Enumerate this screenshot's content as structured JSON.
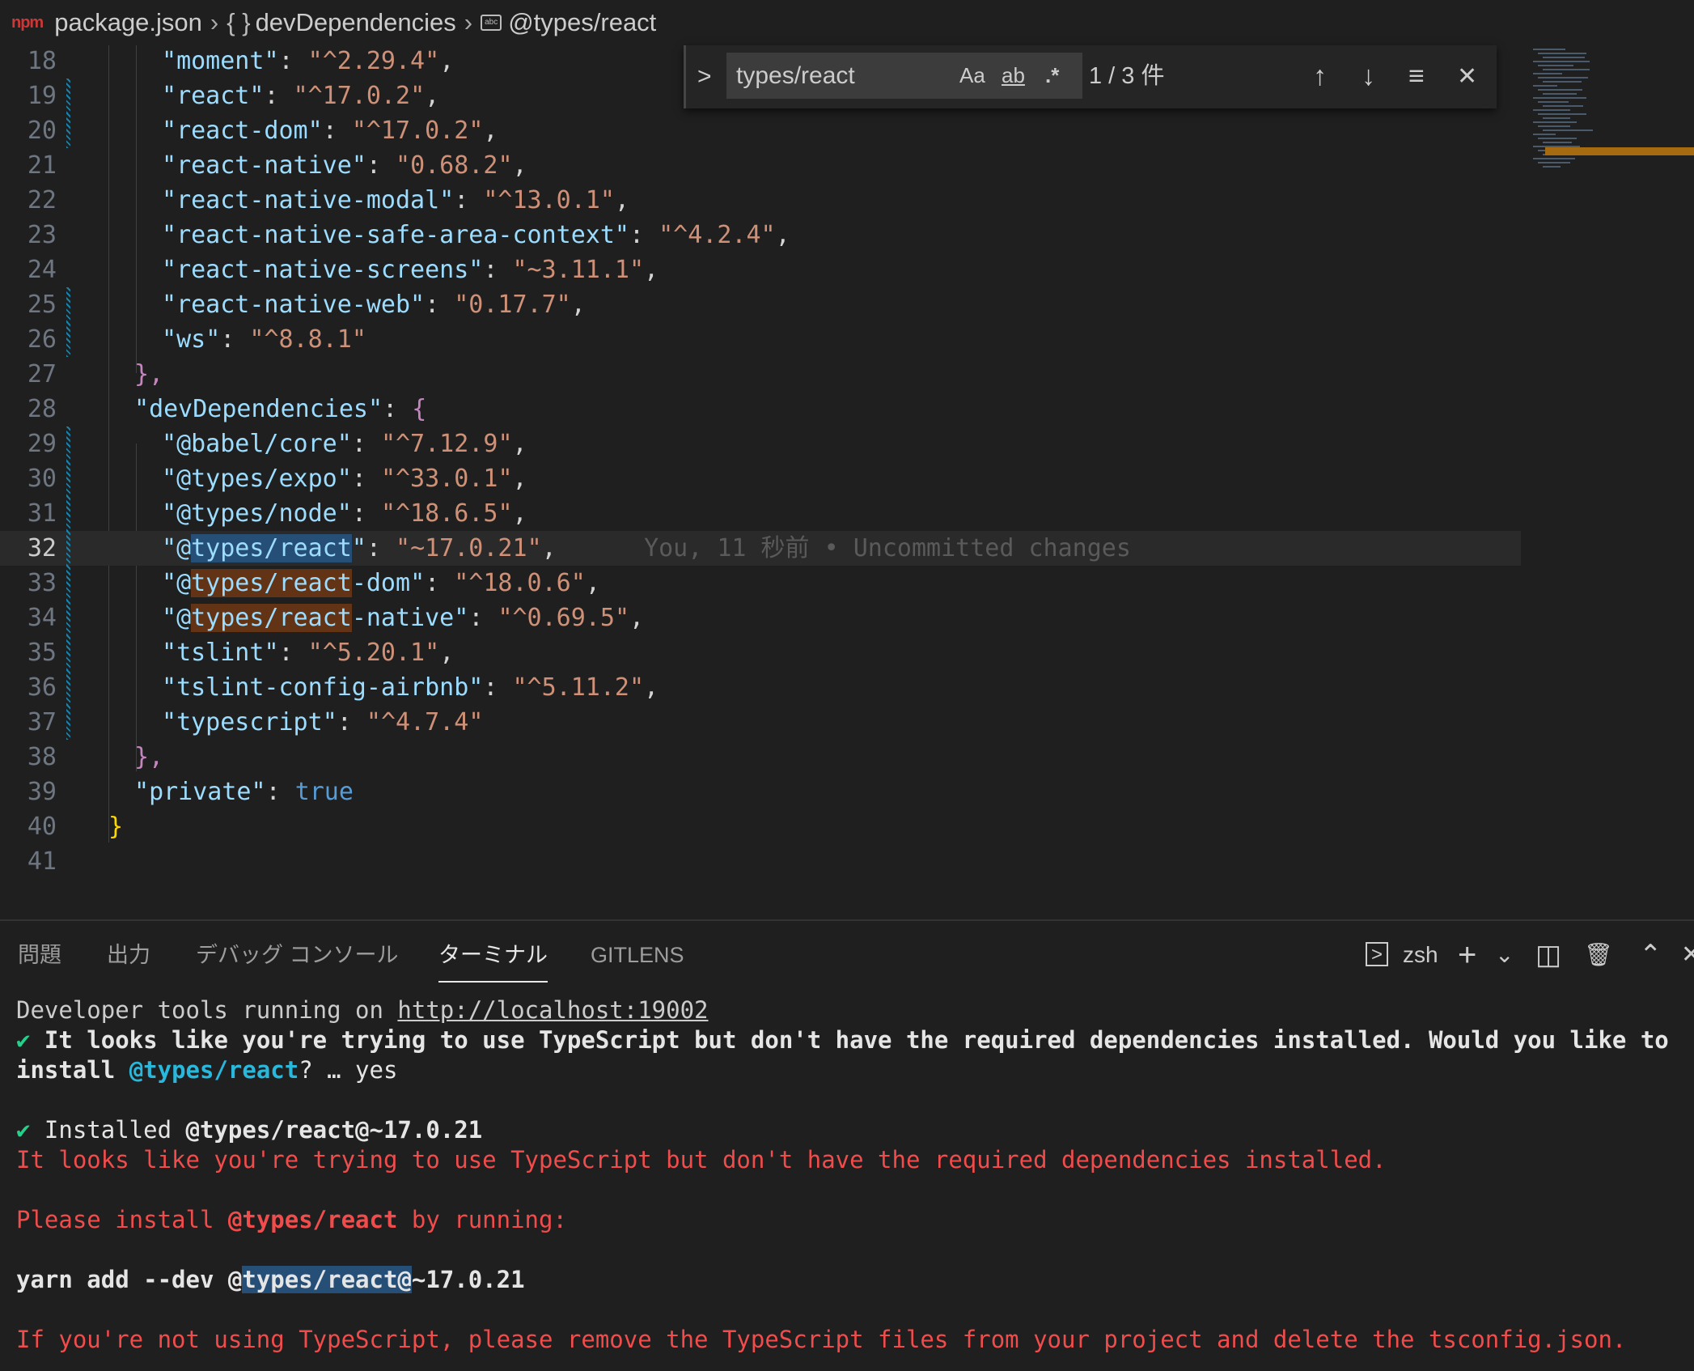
{
  "breadcrumb": {
    "file_badge": "npm",
    "file": "package.json",
    "braces_icon": "{ }",
    "section": "devDependencies",
    "leaf": "@types/react"
  },
  "code_lines": [
    {
      "num": "18",
      "key": "moment",
      "value": "^2.29.4",
      "trail": ","
    },
    {
      "num": "19",
      "key": "react",
      "value": "^17.0.2",
      "trail": ","
    },
    {
      "num": "20",
      "key": "react-dom",
      "value": "^17.0.2",
      "trail": ","
    },
    {
      "num": "21",
      "key": "react-native",
      "value": "0.68.2",
      "trail": ","
    },
    {
      "num": "22",
      "key": "react-native-modal",
      "value": "^13.0.1",
      "trail": ","
    },
    {
      "num": "23",
      "key": "react-native-safe-area-context",
      "value": "^4.2.4",
      "trail": ","
    },
    {
      "num": "24",
      "key": "react-native-screens",
      "value": "~3.11.1",
      "trail": ","
    },
    {
      "num": "25",
      "key": "react-native-web",
      "value": "0.17.7",
      "trail": ","
    },
    {
      "num": "26",
      "key": "ws",
      "value": "^8.8.1",
      "trail": ""
    },
    {
      "num": "27",
      "text": "},"
    },
    {
      "num": "28",
      "key": "devDependencies",
      "open": "{"
    },
    {
      "num": "29",
      "key": "@babel/core",
      "value": "^7.12.9",
      "trail": ","
    },
    {
      "num": "30",
      "key": "@types/expo",
      "value": "^33.0.1",
      "trail": ","
    },
    {
      "num": "31",
      "key": "@types/node",
      "value": "^18.6.5",
      "trail": ","
    },
    {
      "num": "32",
      "key_pre": "@",
      "key_match": "types/react",
      "key_post": "",
      "value": "~17.0.21",
      "trail": ",",
      "annotation": "You, 11 秒前 • Uncommitted changes"
    },
    {
      "num": "33",
      "key_pre": "@",
      "key_match": "types/react",
      "key_post": "-dom",
      "value": "^18.0.6",
      "trail": ","
    },
    {
      "num": "34",
      "key_pre": "@",
      "key_match": "types/react",
      "key_post": "-native",
      "value": "^0.69.5",
      "trail": ","
    },
    {
      "num": "35",
      "key": "tslint",
      "value": "^5.20.1",
      "trail": ","
    },
    {
      "num": "36",
      "key": "tslint-config-airbnb",
      "value": "^5.11.2",
      "trail": ","
    },
    {
      "num": "37",
      "key": "typescript",
      "value": "^4.7.4",
      "trail": ""
    },
    {
      "num": "38",
      "text": "},"
    },
    {
      "num": "39",
      "key": "private",
      "bool": "true"
    },
    {
      "num": "40",
      "text": "}"
    },
    {
      "num": "41",
      "text": ""
    }
  ],
  "find": {
    "expand": ">",
    "query": "types/react",
    "opt_case": "Aa",
    "opt_word": "ab",
    "opt_regex": ".*",
    "count": "1 / 3 件",
    "prev": "↑",
    "next": "↓",
    "selection": "≡",
    "close": "✕"
  },
  "panel": {
    "tabs": [
      "問題",
      "出力",
      "デバッグ コンソール",
      "ターミナル",
      "GITLENS"
    ],
    "active_tab": "ターミナル",
    "shell_icon": ">",
    "shell": "zsh",
    "add": "+",
    "add_menu": "⌄",
    "split": "◫",
    "trash": "🗑",
    "maximize": "⌃",
    "close": "✕"
  },
  "terminal": {
    "l1_pre": "Developer tools running on ",
    "l1_link": "http://localhost:19002",
    "l2_check": "✔",
    "l2_text": " It looks like you're trying to use TypeScript but don't have the required dependencies installed. Would you like to",
    "l3_pre": "install ",
    "l3_pkg": "@types/react",
    "l3_post": "? … yes",
    "l4_check": "✔",
    "l4_pre": " Installed ",
    "l4_pkg": "@types/react@~17.0.21",
    "l5": "It looks like you're trying to use TypeScript but don't have the required dependencies installed.",
    "l6_pre": "Please install ",
    "l6_pkg": "@types/react",
    "l6_post": " by running:",
    "l7_pre": "yarn add --dev @",
    "l7_hl": "types/react@",
    "l7_post": "~17.0.21",
    "l8": "If you're not using TypeScript, please remove the TypeScript files from your project and delete the tsconfig.json."
  },
  "colors": {
    "editor_bg": "#1f1f1f",
    "json_key": "#9cdcfe",
    "json_string": "#ce9178",
    "error_red": "#f14c4c",
    "success_green": "#23d18b",
    "find_match_current": "#264f78",
    "find_match_other": "#623315"
  }
}
